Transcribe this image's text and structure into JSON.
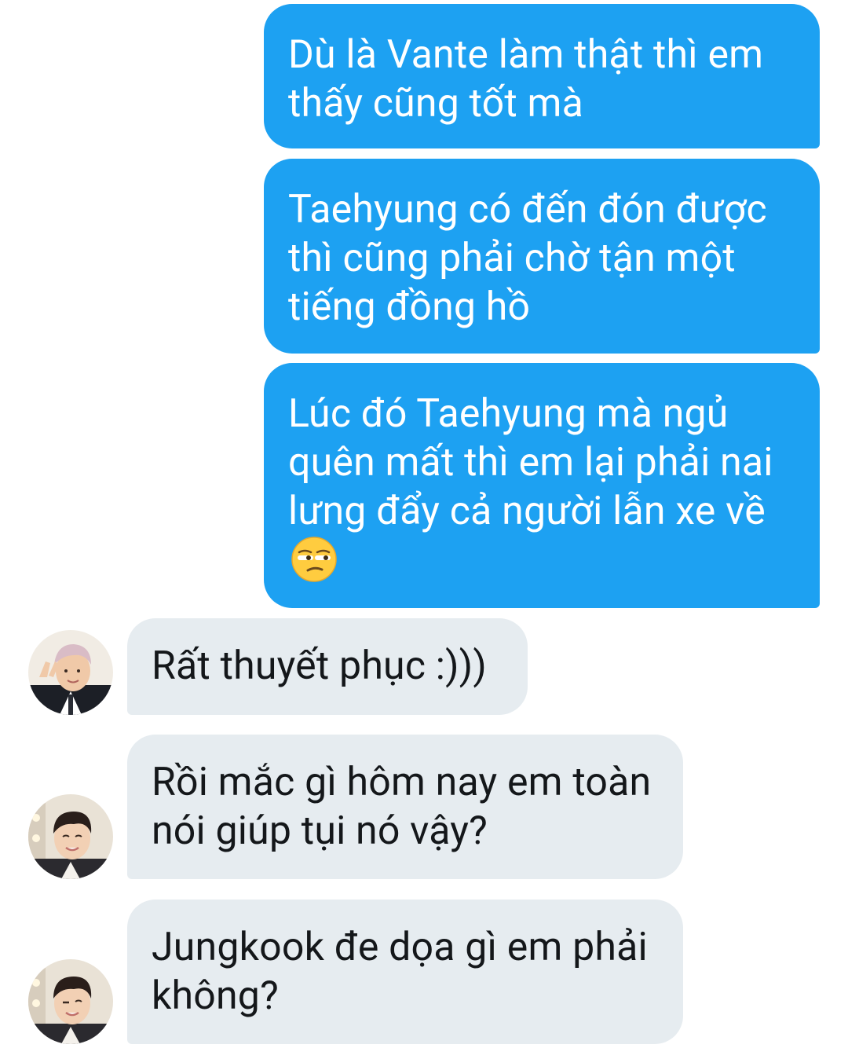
{
  "messages": [
    {
      "direction": "sent",
      "text": "Dù là Vante làm thật thì em thấy cũng tốt mà"
    },
    {
      "direction": "sent",
      "text": "Taehyung có đến đón được thì cũng phải chờ tận một tiếng đồng hồ"
    },
    {
      "direction": "sent",
      "text": "Lúc đó Taehyung mà ngủ quên mất thì em lại phải nai lưng đẩy cả người lẫn xe về",
      "emoji": "unamused-face-emoji"
    },
    {
      "direction": "received",
      "avatar": "avatar-pink-hair-suit",
      "text": "Rất thuyết phục :)))"
    },
    {
      "direction": "received",
      "avatar": "avatar-dark-hair",
      "text": "Rồi mắc gì hôm nay em toàn nói giúp tụi nó vậy?"
    },
    {
      "direction": "received",
      "avatar": "avatar-dark-hair",
      "text": "Jungkook đe dọa gì em phải không?"
    }
  ],
  "colors": {
    "sent_bubble": "#1da1f2",
    "sent_text": "#ffffff",
    "received_bubble": "#e6ecf0",
    "received_text": "#14171a"
  }
}
